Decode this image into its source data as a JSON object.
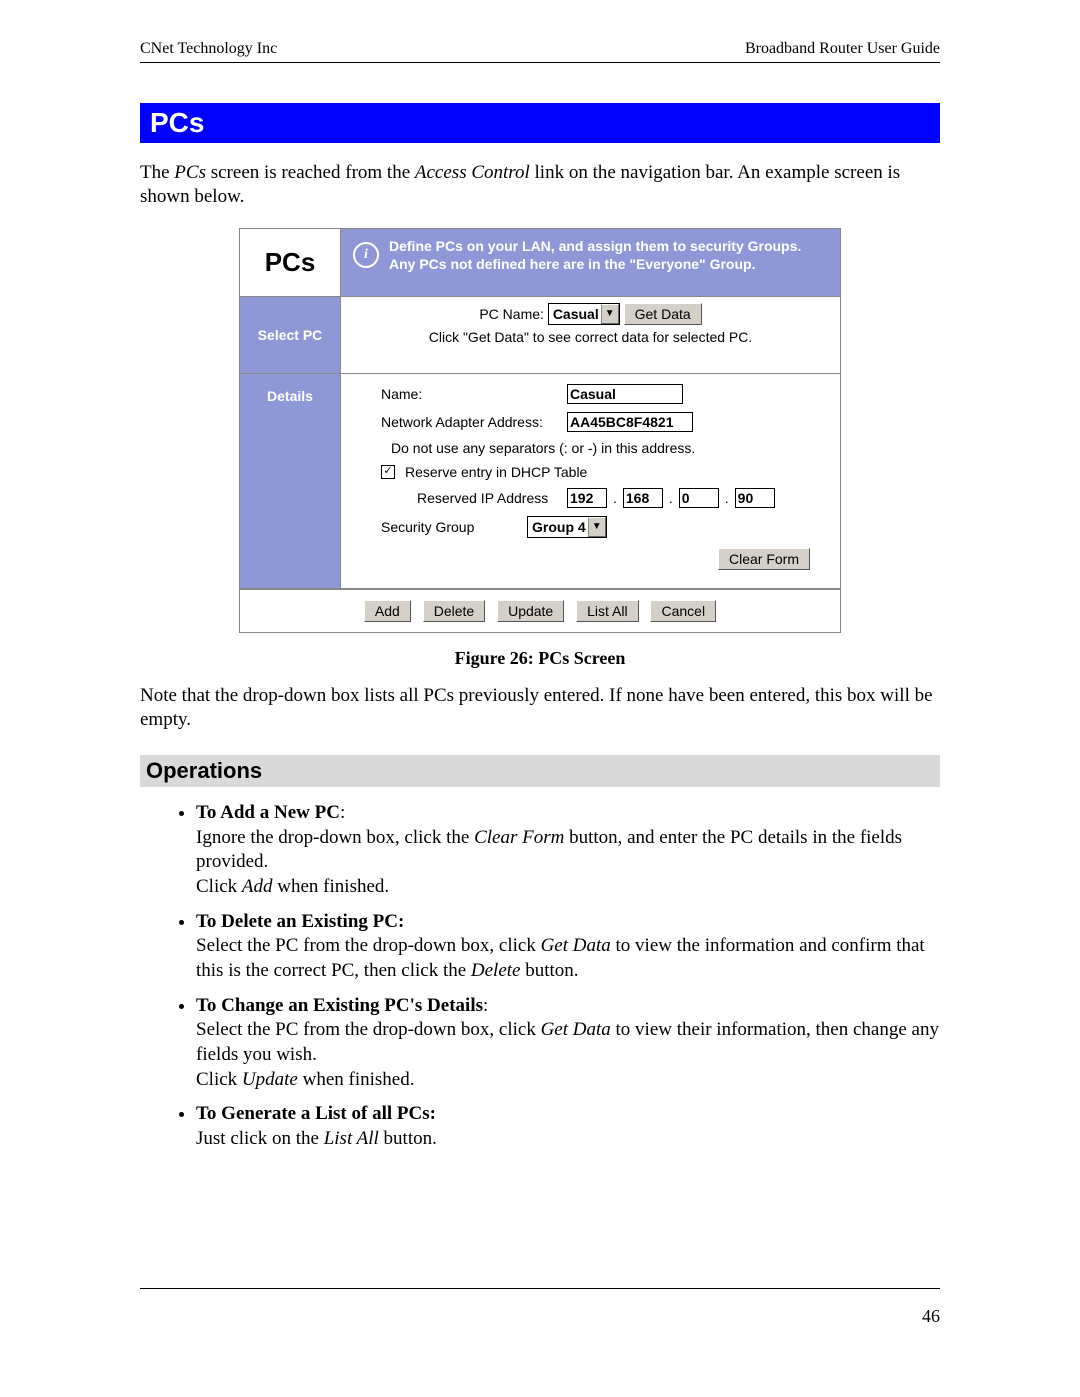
{
  "header": {
    "left": "CNet Technology Inc",
    "right": "Broadband Router User Guide"
  },
  "sectionTitle": "PCs",
  "intro": {
    "t1": "The ",
    "i1": "PCs",
    "t2": " screen is reached from the ",
    "i2": "Access Control",
    "t3": " link on the navigation bar. An example screen is shown below."
  },
  "ui": {
    "pcsLabel": "PCs",
    "infoText": "Define PCs on your LAN, and assign them to security Groups. Any PCs not defined here are in the \"Everyone\" Group.",
    "selectPcLabel": "Select PC",
    "pcNameLabel": "PC Name:",
    "pcNameSelected": "Casual",
    "getDataBtn": "Get Data",
    "selectHint": "Click \"Get Data\" to see correct data for selected PC.",
    "detailsLabel": "Details",
    "nameLabel": "Name:",
    "nameValue": "Casual",
    "adapterLabel": "Network Adapter Address:",
    "adapterValue": "AA45BC8F4821",
    "separatorsNote": "Do not use any separators (: or -) in this address.",
    "reserveLabel": "Reserve entry in DHCP Table",
    "reserveChecked": "✓",
    "reservedIpLabel": "Reserved IP Address",
    "ip1": "192",
    "ip2": "168",
    "ip3": "0",
    "ip4": "90",
    "secGroupLabel": "Security Group",
    "secGroupValue": "Group 4",
    "clearFormBtn": "Clear Form",
    "addBtn": "Add",
    "deleteBtn": "Delete",
    "updateBtn": "Update",
    "listAllBtn": "List All",
    "cancelBtn": "Cancel"
  },
  "caption": "Figure 26: PCs Screen",
  "note": "Note that the drop-down box lists all PCs previously entered. If none have been entered, this box will be empty.",
  "opsHeading": "Operations",
  "ops": {
    "add": {
      "lead": "To Add a New PC",
      "colon": ":",
      "l1a": "Ignore the drop-down box, click the ",
      "l1i": "Clear Form",
      "l1b": " button, and enter the PC details in the fields provided.",
      "l2a": "Click ",
      "l2i": "Add",
      "l2b": " when finished."
    },
    "del": {
      "lead": "To Delete an Existing PC:",
      "l1a": "Select the PC from the drop-down box, click ",
      "l1i": "Get Data",
      "l1b": " to view the information and confirm that this is the correct PC, then click the ",
      "l1i2": "Delete",
      "l1c": " button."
    },
    "chg": {
      "lead": "To Change an Existing PC's Details",
      "colon": ":",
      "l1a": "Select the PC from the drop-down box, click ",
      "l1i": "Get Data",
      "l1b": " to view their information, then change any fields you wish.",
      "l2a": "Click ",
      "l2i": "Update",
      "l2b": " when finished."
    },
    "list": {
      "lead": "To Generate a List of all PCs:",
      "l1a": "Just click on the ",
      "l1i": "List All",
      "l1b": " button."
    }
  },
  "pageNumber": "46"
}
